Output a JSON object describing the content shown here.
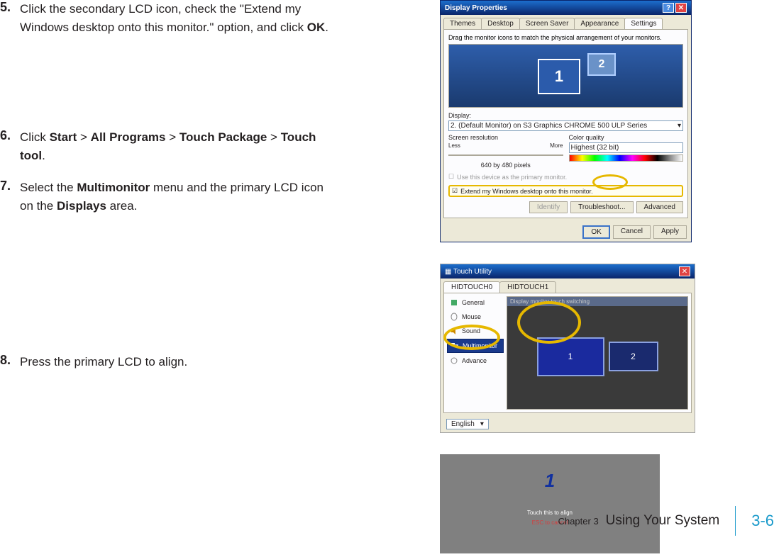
{
  "steps": {
    "s5": {
      "num": "5.",
      "text_a": "Click the secondary LCD icon, check the \"Extend my Windows desktop onto this monitor.\" option, and click ",
      "text_b": "OK",
      "text_c": "."
    },
    "s6": {
      "num": "6.",
      "text_a": "Click ",
      "b1": "Start",
      "g1": " > ",
      "b2": "All Programs",
      "g2": " > ",
      "b3": "Touch Package",
      "g3": " > ",
      "b4": "Touch tool",
      "text_c": "."
    },
    "s7": {
      "num": "7.",
      "text_a": "Select the ",
      "b1": "Multimonitor",
      "text_b": " menu and the primary LCD icon on the ",
      "b2": "Displays",
      "text_c": " area."
    },
    "s8": {
      "num": "8.",
      "text_a": "Press the primary LCD to align."
    }
  },
  "dp": {
    "title": "Display Properties",
    "tabs": {
      "t1": "Themes",
      "t2": "Desktop",
      "t3": "Screen Saver",
      "t4": "Appearance",
      "t5": "Settings"
    },
    "hint": "Drag the monitor icons to match the physical arrangement of your monitors.",
    "mon1": "1",
    "mon2": "2",
    "display_label": "Display:",
    "display_value": "2. (Default Monitor) on S3 Graphics CHROME 500 ULP Series",
    "res_label": "Screen resolution",
    "less": "Less",
    "more": "More",
    "res_value": "640 by 480 pixels",
    "qual_label": "Color quality",
    "qual_value": "Highest (32 bit)",
    "chk1": "Use this device as the primary monitor.",
    "chk2": "Extend my Windows desktop onto this monitor.",
    "identify": "Identify",
    "troubleshoot": "Troubleshoot...",
    "advanced": "Advanced",
    "ok": "OK",
    "cancel": "Cancel",
    "apply": "Apply"
  },
  "tu": {
    "title": "Touch Utility",
    "tab1": "HIDTOUCH0",
    "tab2": "HIDTOUCH1",
    "side": {
      "general": "General",
      "mouse": "Mouse",
      "sound": "Sound",
      "multi": "Multimonitor",
      "advance": "Advance"
    },
    "main_head": "Display monitor touch switching",
    "mon1": "1",
    "mon2": "2",
    "lang_label": "English"
  },
  "align": {
    "num": "1",
    "t1": "Touch this to align",
    "t2": "ESC to cancel"
  },
  "footer": {
    "chapter": "Chapter 3",
    "title": "Using Your System",
    "page": "3-6"
  }
}
